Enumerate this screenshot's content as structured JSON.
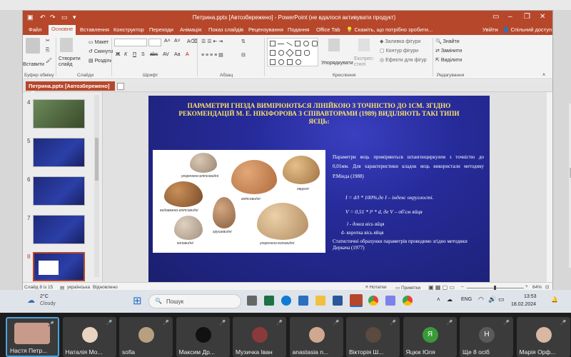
{
  "window": {
    "title": "Петрина.pptx [Автозбережено] - PowerPoint (не вдалося активувати продукт)",
    "login": "Увійти",
    "share": "Спільний доступ"
  },
  "menu": [
    "Файл",
    "Основне",
    "Вставлення",
    "Конструктор",
    "Переходи",
    "Анімація",
    "Показ слайдів",
    "Рецензування",
    "Подання",
    "Office Tab"
  ],
  "tell_me": "Скажіть, що потрібно зробити...",
  "ribbon": {
    "paste": "Вставити",
    "create_slide": "Створити слайд",
    "layout": "Макет",
    "reset": "Скинути",
    "sections": "Розділи",
    "arrange": "Упорядкувати",
    "express": "Експрес-стилі",
    "fill": "Заливка фігури",
    "outline": "Контур фігури",
    "effects": "Ефекти для фігур",
    "find": "Знайти",
    "replace": "Замінити",
    "select": "Виділити",
    "groups": [
      "Буфер обміну",
      "Слайди",
      "Шрифт",
      "Абзац",
      "Креслення",
      "Редагування"
    ]
  },
  "doc_tab": "Петрина.pptx [Автозбережено]",
  "thumbnails": [
    "4",
    "5",
    "6",
    "7",
    "8"
  ],
  "slide": {
    "title": "ПАРАМЕТРИ ГНІЗДА ВИМІРЮЮТЬСЯ ЛІНІЙКОЮ З ТОЧНІСТЮ ДО 1СМ. ЗГІДНО РЕКОМЕНДАЦІЙ М. Е. НІКІФОРОВА З СПІВАВТОРАМИ (1989) ВИДІЛЯЮТЬ ТАКІ ТИПИ ЯЄЦЬ:",
    "para1": "Параметри яєць проміряються штангенциркулем з точністю до 0,01мм. Для характеристики кладок яєць використали методику Р.Мінда (1988)",
    "formula1": "I = d/l * 100%,де  I – індекс округлості.",
    "formula2": "V = 0,51 * l² * d, де V – об'єм яйця",
    "l_def": "l - довга вісь яйця",
    "d_def": "d- коротка вісь яйця",
    "para2": "Статистичні обрахунки параметрів проводимо згідно методики Деркача (1977)",
    "egg_labels": [
      "укорочено-еліпсовидні",
      "округлі",
      "еліпсовидні",
      "видовжено-еліпсовидні",
      "грушевидні",
      "коповидні",
      "укорочено-коповидні"
    ]
  },
  "status": {
    "slide": "Слайд 8 із 15",
    "lang": "українська",
    "restored": "Відновлено",
    "notes": "Нотатки",
    "comments": "Примітки",
    "zoom": "64%"
  },
  "taskbar": {
    "temp": "2°C",
    "weather": "Cloudy",
    "search": "Пошук",
    "lang": "ENG",
    "time": "13:53",
    "date": "18.02.2024"
  },
  "participants": [
    {
      "name": "Настя Петр...",
      "color": "#c89a8a"
    },
    {
      "name": "Наталія Мо...",
      "color": "#e8d4c0"
    },
    {
      "name": "sofia",
      "color": "#b7a080"
    },
    {
      "name": "Максим Др...",
      "color": "#111111"
    },
    {
      "name": "Музичка Іван",
      "color": "#8a3a3a"
    },
    {
      "name": "anastasia n...",
      "color": "#d0a890"
    },
    {
      "name": "Вікторія Ш...",
      "color": "#5a4a40"
    },
    {
      "name": "Яцюк Юля",
      "color": "#3a9a3a",
      "letter": "Я"
    },
    {
      "name": "Ще 8 осіб",
      "color": "#5a5a5a",
      "letter": "Н"
    },
    {
      "name": "Марія Орф...",
      "color": "#d8b8a0"
    }
  ]
}
